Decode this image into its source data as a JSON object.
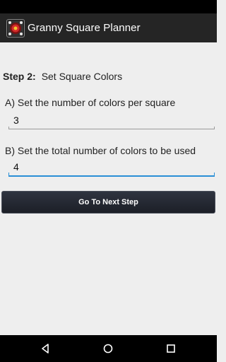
{
  "app": {
    "title": "Granny Square Planner"
  },
  "step": {
    "label": "Step 2:",
    "title": "Set Square Colors"
  },
  "fields": {
    "colors_per_square": {
      "label": "A) Set the number of colors per square",
      "value": "3"
    },
    "total_colors": {
      "label": "B) Set the total number of colors to be used",
      "value": "4"
    }
  },
  "actions": {
    "next_label": "Go To Next Step"
  },
  "colors": {
    "action_bar": "#252525",
    "focus_underline": "#2a8fd6",
    "background": "#eeeeee"
  },
  "icons": {
    "app": "granny-square-icon",
    "nav": [
      "back-icon",
      "home-icon",
      "recent-apps-icon"
    ]
  }
}
